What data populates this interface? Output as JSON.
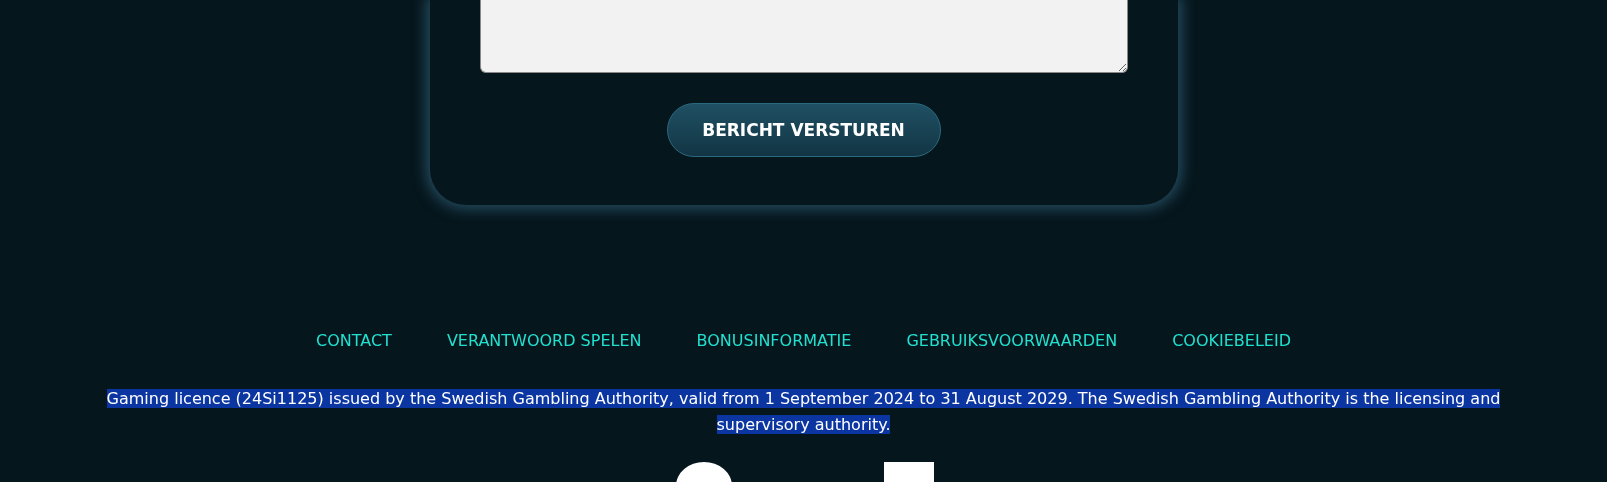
{
  "form": {
    "submit_button": "BERICHT VERSTUREN"
  },
  "footer": {
    "links": [
      "CONTACT",
      "VERANTWOORD SPELEN",
      "BONUSINFORMATIE",
      "GEBRUIKSVOORWAARDEN",
      "COOKIEBELEID"
    ],
    "licence_text": "Gaming licence (24Si1125) issued by the Swedish Gambling Authority, valid from 1 September 2024 to 31 August 2029. The Swedish Gambling Authority is the licensing and supervisory authority."
  }
}
